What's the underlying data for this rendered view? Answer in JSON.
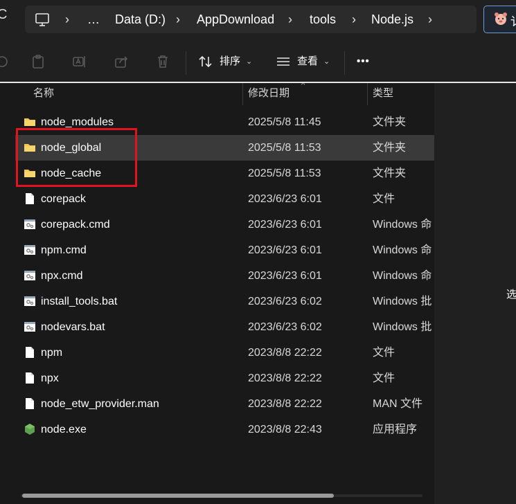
{
  "address_bar": {
    "left_cut_glyph": "C",
    "segments": [
      "…",
      "Data (D:)",
      "AppDownload",
      "tools",
      "Node.js"
    ],
    "search_partial": "讠"
  },
  "toolbar": {
    "sort_label": "排序",
    "view_label": "查看",
    "more_label": "•••"
  },
  "columns": {
    "name": "名称",
    "date": "修改日期",
    "type": "类型"
  },
  "files": [
    {
      "name": "node_modules",
      "date": "2025/5/8 11:45",
      "type": "文件夹",
      "icon": "folder-icon"
    },
    {
      "name": "node_global",
      "date": "2025/5/8 11:53",
      "type": "文件夹",
      "icon": "folder-icon"
    },
    {
      "name": "node_cache",
      "date": "2025/5/8 11:53",
      "type": "文件夹",
      "icon": "folder-icon"
    },
    {
      "name": "corepack",
      "date": "2023/6/23 6:01",
      "type": "文件",
      "icon": "file-icon"
    },
    {
      "name": "corepack.cmd",
      "date": "2023/6/23 6:01",
      "type": "Windows 命",
      "icon": "cmd-file-icon"
    },
    {
      "name": "npm.cmd",
      "date": "2023/6/23 6:01",
      "type": "Windows 命",
      "icon": "cmd-file-icon"
    },
    {
      "name": "npx.cmd",
      "date": "2023/6/23 6:01",
      "type": "Windows 命",
      "icon": "cmd-file-icon"
    },
    {
      "name": "install_tools.bat",
      "date": "2023/6/23 6:02",
      "type": "Windows 批",
      "icon": "cmd-file-icon"
    },
    {
      "name": "nodevars.bat",
      "date": "2023/6/23 6:02",
      "type": "Windows 批",
      "icon": "cmd-file-icon"
    },
    {
      "name": "npm",
      "date": "2023/8/8 22:22",
      "type": "文件",
      "icon": "file-icon"
    },
    {
      "name": "npx",
      "date": "2023/8/8 22:22",
      "type": "文件",
      "icon": "file-icon"
    },
    {
      "name": "node_etw_provider.man",
      "date": "2023/8/8 22:22",
      "type": "MAN 文件",
      "icon": "file-icon"
    },
    {
      "name": "node.exe",
      "date": "2023/8/8 22:43",
      "type": "应用程序",
      "icon": "node-exe-icon"
    }
  ],
  "selected_index": 1,
  "details_pane": {
    "partial_text": "选"
  },
  "colors": {
    "highlight_box": "#e0141e",
    "folder": "#f2c94c",
    "node_green": "#5fa04e",
    "accent_border": "#6c9ed4"
  }
}
